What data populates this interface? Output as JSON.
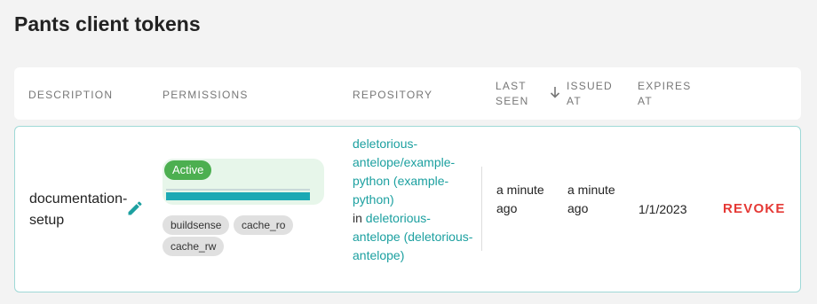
{
  "page": {
    "title": "Pants client tokens"
  },
  "table": {
    "headers": {
      "description": "DESCRIPTION",
      "permissions": "PERMISSIONS",
      "repository": "REPOSITORY",
      "last_seen_1": "LAST",
      "last_seen_2": "SEEN",
      "issued_at_1": "ISSUED",
      "issued_at_2": "AT",
      "expires_at_1": "EXPIRES",
      "expires_at_2": "AT"
    },
    "sort_icon": "arrow-down-icon",
    "rows": [
      {
        "description_1": "documentation-",
        "description_2": "setup",
        "edit_icon": "pencil-icon",
        "status": "Active",
        "permissions": [
          "buildsense",
          "cache_ro",
          "cache_rw"
        ],
        "repo_link_1": "deletorious-antelope/example-python (example-python)",
        "repo_in": "in",
        "repo_link_2": "deletorious-antelope (deletorious-antelope)",
        "last_seen": "a minute ago",
        "issued_at": "a minute ago",
        "expires_at": "1/1/2023",
        "revoke_label": "REVOKE"
      }
    ]
  },
  "colors": {
    "accent": "#1ca0a0",
    "active_badge": "#4caf50",
    "revoke": "#e53935",
    "row_border": "#9fd9d7"
  }
}
